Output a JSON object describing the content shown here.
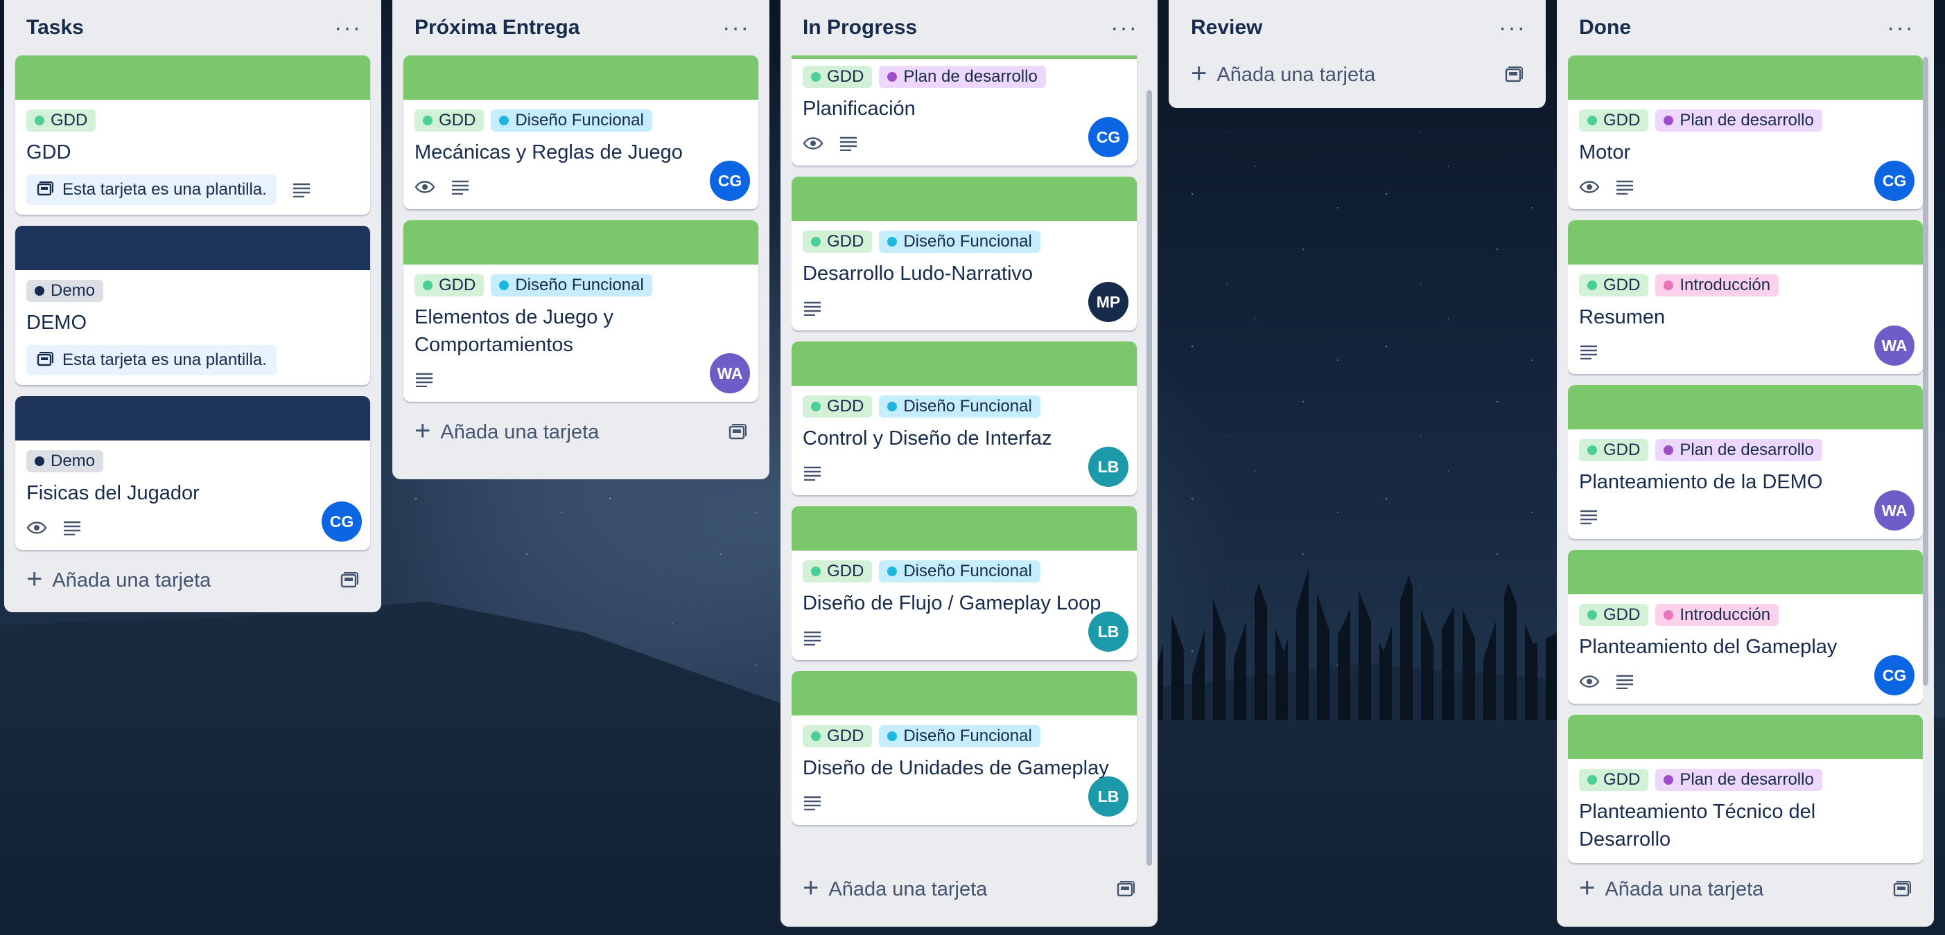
{
  "colors": {
    "cover_green": "#7bc86c",
    "cover_navy": "#1f345a",
    "label_gdd_bg": "#d3f1d6",
    "label_gdd_dot": "#4bce97",
    "label_demo_bg": "#dcdfe4",
    "label_demo_dot": "#172b4d",
    "label_funcional_bg": "#c6edfb",
    "label_funcional_dot": "#1fb6dd",
    "label_plan_bg": "#eed7fc",
    "label_plan_dot": "#9f4dc6",
    "label_intro_bg": "#fdd0ec",
    "label_intro_dot": "#e774bb",
    "avatar_cg": "#0c66e4",
    "avatar_mp": "#172b4d",
    "avatar_wa": "#6e5dc6",
    "avatar_lb": "#1d9aaa"
  },
  "icons": {
    "menu": "ellipsis-icon",
    "description": "description-icon",
    "watch": "eye-icon",
    "template": "template-card-icon",
    "add": "plus-icon"
  },
  "lists": [
    {
      "title": "Tasks",
      "add_label": "Añada una tarjeta",
      "cards": [
        {
          "title": "GDD",
          "labels": [
            {
              "text": "GDD"
            }
          ],
          "template_text": "Esta tarjeta es una plantilla."
        },
        {
          "title": "DEMO",
          "labels": [
            {
              "text": "Demo"
            }
          ],
          "template_text": "Esta tarjeta es una plantilla."
        },
        {
          "title": "Fisicas del Jugador",
          "labels": [
            {
              "text": "Demo"
            }
          ],
          "avatar": "CG"
        }
      ]
    },
    {
      "title": "Próxima Entrega",
      "add_label": "Añada una tarjeta",
      "cards": [
        {
          "title": "Mecánicas y Reglas de Juego",
          "labels": [
            {
              "text": "GDD"
            },
            {
              "text": "Diseño Funcional"
            }
          ],
          "avatar": "CG"
        },
        {
          "title": "Elementos de Juego y Comportamientos",
          "labels": [
            {
              "text": "GDD"
            },
            {
              "text": "Diseño Funcional"
            }
          ],
          "avatar": "WA"
        }
      ]
    },
    {
      "title": "In Progress",
      "add_label": "Añada una tarjeta",
      "cards": [
        {
          "title": "Planificación",
          "labels": [
            {
              "text": "GDD"
            },
            {
              "text": "Plan de desarrollo"
            }
          ],
          "avatar": "CG"
        },
        {
          "title": "Desarrollo Ludo-Narrativo",
          "labels": [
            {
              "text": "GDD"
            },
            {
              "text": "Diseño Funcional"
            }
          ],
          "avatar": "MP"
        },
        {
          "title": "Control y Diseño de Interfaz",
          "labels": [
            {
              "text": "GDD"
            },
            {
              "text": "Diseño Funcional"
            }
          ],
          "avatar": "LB"
        },
        {
          "title": "Diseño de Flujo / Gameplay Loop",
          "labels": [
            {
              "text": "GDD"
            },
            {
              "text": "Diseño Funcional"
            }
          ],
          "avatar": "LB"
        },
        {
          "title": "Diseño de Unidades de Gameplay",
          "labels": [
            {
              "text": "GDD"
            },
            {
              "text": "Diseño Funcional"
            }
          ],
          "avatar": "LB"
        }
      ]
    },
    {
      "title": "Review",
      "add_label": "Añada una tarjeta",
      "cards": []
    },
    {
      "title": "Done",
      "add_label": "Añada una tarjeta",
      "cards": [
        {
          "title": "Motor",
          "labels": [
            {
              "text": "GDD"
            },
            {
              "text": "Plan de desarrollo"
            }
          ],
          "avatar": "CG"
        },
        {
          "title": "Resumen",
          "labels": [
            {
              "text": "GDD"
            },
            {
              "text": "Introducción"
            }
          ],
          "avatar": "WA"
        },
        {
          "title": "Planteamiento de la DEMO",
          "labels": [
            {
              "text": "GDD"
            },
            {
              "text": "Plan de desarrollo"
            }
          ],
          "avatar": "WA"
        },
        {
          "title": "Planteamiento del Gameplay",
          "labels": [
            {
              "text": "GDD"
            },
            {
              "text": "Introducción"
            }
          ],
          "avatar": "CG"
        },
        {
          "title": "Planteamiento Técnico del Desarrollo",
          "labels": [
            {
              "text": "GDD"
            },
            {
              "text": "Plan de desarrollo"
            }
          ]
        }
      ]
    }
  ]
}
